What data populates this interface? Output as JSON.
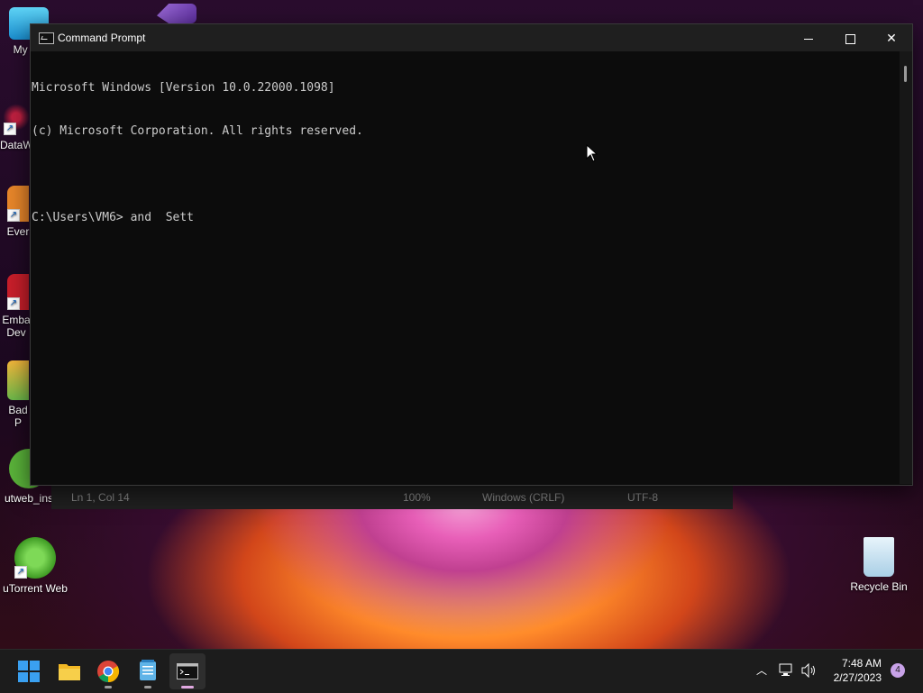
{
  "desktop": {
    "icons": [
      {
        "label": "My Co"
      },
      {
        "label": "DataW"
      },
      {
        "label": "Ever"
      },
      {
        "label": "Emba Dev"
      },
      {
        "label": "Bad P"
      },
      {
        "label": "utweb_ins"
      },
      {
        "label": "uTorrent Web"
      },
      {
        "label": "Recycle Bin"
      }
    ]
  },
  "notepad_status": {
    "position": "Ln 1, Col 14",
    "zoom": "100%",
    "line_ending": "Windows (CRLF)",
    "encoding": "UTF-8"
  },
  "cmd": {
    "title": "Command Prompt",
    "lines": [
      "Microsoft Windows [Version 10.0.22000.1098]",
      "(c) Microsoft Corporation. All rights reserved.",
      "",
      "C:\\Users\\VM6> and  Sett"
    ]
  },
  "taskbar": {
    "apps": [
      "start",
      "file-explorer",
      "chrome",
      "notepad",
      "command-prompt"
    ],
    "time": "7:48 AM",
    "date": "2/27/2023",
    "notifications": "4"
  }
}
